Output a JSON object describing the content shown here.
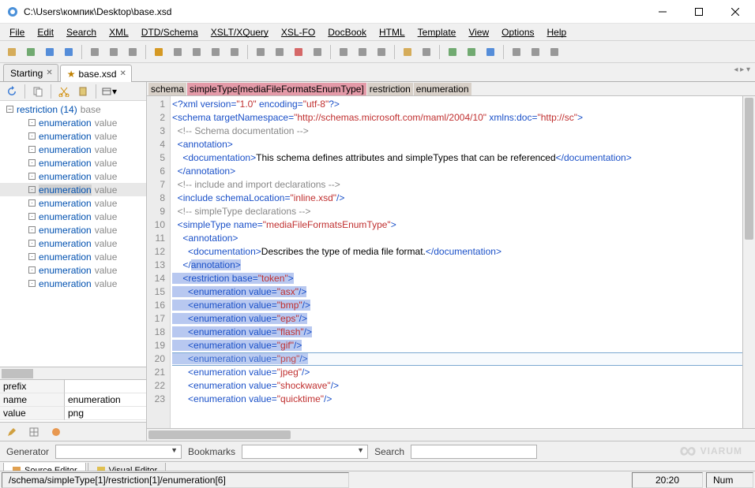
{
  "window": {
    "title": "C:\\Users\\компик\\Desktop\\base.xsd"
  },
  "menu": [
    "File",
    "Edit",
    "Search",
    "XML",
    "DTD/Schema",
    "XSLT/XQuery",
    "XSL-FO",
    "DocBook",
    "HTML",
    "Template",
    "View",
    "Options",
    "Help"
  ],
  "tabs": [
    {
      "label": "Starting",
      "starred": false
    },
    {
      "label": "base.xsd",
      "starred": true
    }
  ],
  "tree": {
    "root": {
      "label": "restriction (14)",
      "extra": "base"
    },
    "items": [
      {
        "label": "enumeration",
        "extra": "value"
      },
      {
        "label": "enumeration",
        "extra": "value"
      },
      {
        "label": "enumeration",
        "extra": "value"
      },
      {
        "label": "enumeration",
        "extra": "value"
      },
      {
        "label": "enumeration",
        "extra": "value"
      },
      {
        "label": "enumeration",
        "extra": "value",
        "selected": true
      },
      {
        "label": "enumeration",
        "extra": "value"
      },
      {
        "label": "enumeration",
        "extra": "value"
      },
      {
        "label": "enumeration",
        "extra": "value"
      },
      {
        "label": "enumeration",
        "extra": "value"
      },
      {
        "label": "enumeration",
        "extra": "value"
      },
      {
        "label": "enumeration",
        "extra": "value"
      },
      {
        "label": "enumeration",
        "extra": "value"
      }
    ]
  },
  "props": [
    {
      "k": "prefix",
      "v": ""
    },
    {
      "k": "name",
      "v": "enumeration"
    },
    {
      "k": "value",
      "v": "png"
    }
  ],
  "breadcrumb": {
    "schema": "schema",
    "simpleType": "simpleType[mediaFileFormatsEnumType]",
    "restriction": "restriction",
    "enumeration": "enumeration"
  },
  "code": {
    "lines": [
      {
        "n": 1,
        "ind": 0,
        "kind": "decl",
        "raw": "<?xml version=\"1.0\" encoding=\"utf-8\"?>"
      },
      {
        "n": 2,
        "ind": 0,
        "kind": "open",
        "tag": "schema",
        "attrs": [
          [
            "targetNamespace",
            "http://schemas.microsoft.com/maml/2004/10"
          ],
          [
            "xmlns:doc",
            "http://sc"
          ]
        ],
        "trunc": true
      },
      {
        "n": 3,
        "ind": 1,
        "kind": "comment",
        "text": "Schema documentation"
      },
      {
        "n": 4,
        "ind": 1,
        "kind": "open",
        "tag": "annotation"
      },
      {
        "n": 5,
        "ind": 2,
        "kind": "tc",
        "tag": "documentation",
        "text": "This schema defines attributes and simpleTypes that can be referenced"
      },
      {
        "n": 6,
        "ind": 1,
        "kind": "close",
        "tag": "annotation"
      },
      {
        "n": 7,
        "ind": 1,
        "kind": "comment",
        "text": "include and import declarations"
      },
      {
        "n": 8,
        "ind": 1,
        "kind": "self",
        "tag": "include",
        "attrs": [
          [
            "schemaLocation",
            "inline.xsd"
          ]
        ]
      },
      {
        "n": 9,
        "ind": 1,
        "kind": "comment",
        "text": "simpleType declarations"
      },
      {
        "n": 10,
        "ind": 1,
        "kind": "open",
        "tag": "simpleType",
        "attrs": [
          [
            "name",
            "mediaFileFormatsEnumType"
          ]
        ]
      },
      {
        "n": 11,
        "ind": 2,
        "kind": "open",
        "tag": "annotation"
      },
      {
        "n": 12,
        "ind": 3,
        "kind": "tc",
        "tag": "documentation",
        "text": "Describes the type of media file format."
      },
      {
        "n": 13,
        "ind": 2,
        "kind": "close",
        "tag": "annotation",
        "hl": "partial"
      },
      {
        "n": 14,
        "ind": 2,
        "kind": "open",
        "tag": "restriction",
        "attrs": [
          [
            "base",
            "token"
          ]
        ],
        "hl": "full"
      },
      {
        "n": 15,
        "ind": 3,
        "kind": "self",
        "tag": "enumeration",
        "attrs": [
          [
            "value",
            "asx"
          ]
        ],
        "hl": "full"
      },
      {
        "n": 16,
        "ind": 3,
        "kind": "self",
        "tag": "enumeration",
        "attrs": [
          [
            "value",
            "bmp"
          ]
        ],
        "hl": "full"
      },
      {
        "n": 17,
        "ind": 3,
        "kind": "self",
        "tag": "enumeration",
        "attrs": [
          [
            "value",
            "eps"
          ]
        ],
        "hl": "full"
      },
      {
        "n": 18,
        "ind": 3,
        "kind": "self",
        "tag": "enumeration",
        "attrs": [
          [
            "value",
            "flash"
          ]
        ],
        "hl": "full"
      },
      {
        "n": 19,
        "ind": 3,
        "kind": "self",
        "tag": "enumeration",
        "attrs": [
          [
            "value",
            "gif"
          ]
        ],
        "hl": "full"
      },
      {
        "n": 20,
        "ind": 3,
        "kind": "self",
        "tag": "enumeration",
        "attrs": [
          [
            "value",
            "png"
          ]
        ],
        "hl": "full",
        "current": true
      },
      {
        "n": 21,
        "ind": 3,
        "kind": "self",
        "tag": "enumeration",
        "attrs": [
          [
            "value",
            "jpeg"
          ]
        ]
      },
      {
        "n": 22,
        "ind": 3,
        "kind": "self",
        "tag": "enumeration",
        "attrs": [
          [
            "value",
            "shockwave"
          ]
        ]
      },
      {
        "n": 23,
        "ind": 3,
        "kind": "self",
        "tag": "enumeration",
        "attrs": [
          [
            "value",
            "quicktime"
          ]
        ]
      }
    ]
  },
  "bottombar": {
    "gen_label": "Generator",
    "bm_label": "Bookmarks",
    "search_label": "Search"
  },
  "lower_tabs": [
    "Source Editor",
    "Visual Editor"
  ],
  "status": {
    "path": "/schema/simpleType[1]/restriction[1]/enumeration[6]",
    "pos": "20:20",
    "mode": "Num"
  },
  "watermark": "VIARUM"
}
